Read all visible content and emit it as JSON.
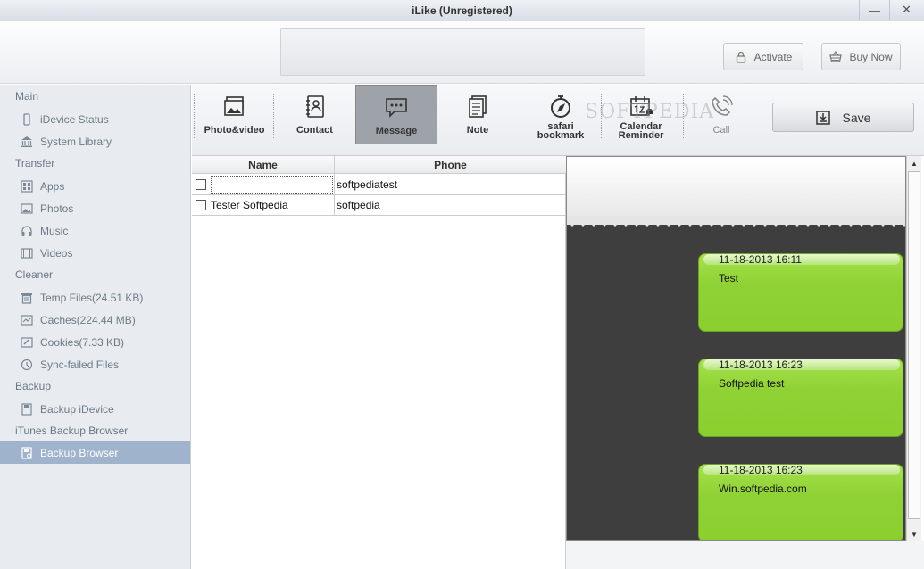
{
  "window": {
    "title": "iLike (Unregistered)",
    "minimize": "—",
    "close": "✕"
  },
  "header": {
    "activate_label": "Activate",
    "buy_label": "Buy Now"
  },
  "sidebar": {
    "sections": [
      "Main",
      "Transfer",
      "Cleaner",
      "Backup",
      "iTunes Backup Browser"
    ],
    "items": [
      {
        "label": "iDevice Status",
        "icon": "phone-icon"
      },
      {
        "label": "System Library",
        "icon": "library-icon"
      },
      {
        "label": "Apps",
        "icon": "apps-icon"
      },
      {
        "label": "Photos",
        "icon": "photo-icon"
      },
      {
        "label": "Music",
        "icon": "headphones-icon"
      },
      {
        "label": "Videos",
        "icon": "film-icon"
      },
      {
        "label": "Temp Files(24.51 KB)",
        "icon": "trash-icon"
      },
      {
        "label": "Caches(224.44 MB)",
        "icon": "cache-icon"
      },
      {
        "label": "Cookies(7.33 KB)",
        "icon": "cookie-icon"
      },
      {
        "label": "Sync-failed Files",
        "icon": "sync-icon"
      },
      {
        "label": "Backup iDevice",
        "icon": "disk-icon"
      },
      {
        "label": "Backup Browser",
        "icon": "backup-browser-icon",
        "active": true
      }
    ]
  },
  "toolbar": {
    "tools": [
      {
        "label": "Photo&video"
      },
      {
        "label": "Contact"
      },
      {
        "label": "Message",
        "selected": true
      },
      {
        "label": "Note"
      },
      {
        "label": "safari",
        "label2": "bookmark"
      },
      {
        "label": "Calendar",
        "label2": "Reminder"
      },
      {
        "label": "Call",
        "disabled": true
      }
    ],
    "save_label": "Save",
    "watermark": "SOFTPEDIA"
  },
  "table": {
    "headers": {
      "name": "Name",
      "phone": "Phone"
    },
    "rows": [
      {
        "name": "",
        "phone": "softpediatest",
        "checked": false
      },
      {
        "name": "Tester Softpedia",
        "phone": "softpedia",
        "checked": false
      }
    ]
  },
  "messages": [
    {
      "timestamp": "11-18-2013 16:11",
      "text": "Test"
    },
    {
      "timestamp": "11-18-2013 16:23",
      "text": "Softpedia test"
    },
    {
      "timestamp": "11-18-2013 16:23",
      "text": "Win.softpedia.com"
    }
  ],
  "colors": {
    "bubble": "#8fd234",
    "sidebar_active": "#9fb3cc",
    "preview_bg": "#3e3e3e"
  }
}
